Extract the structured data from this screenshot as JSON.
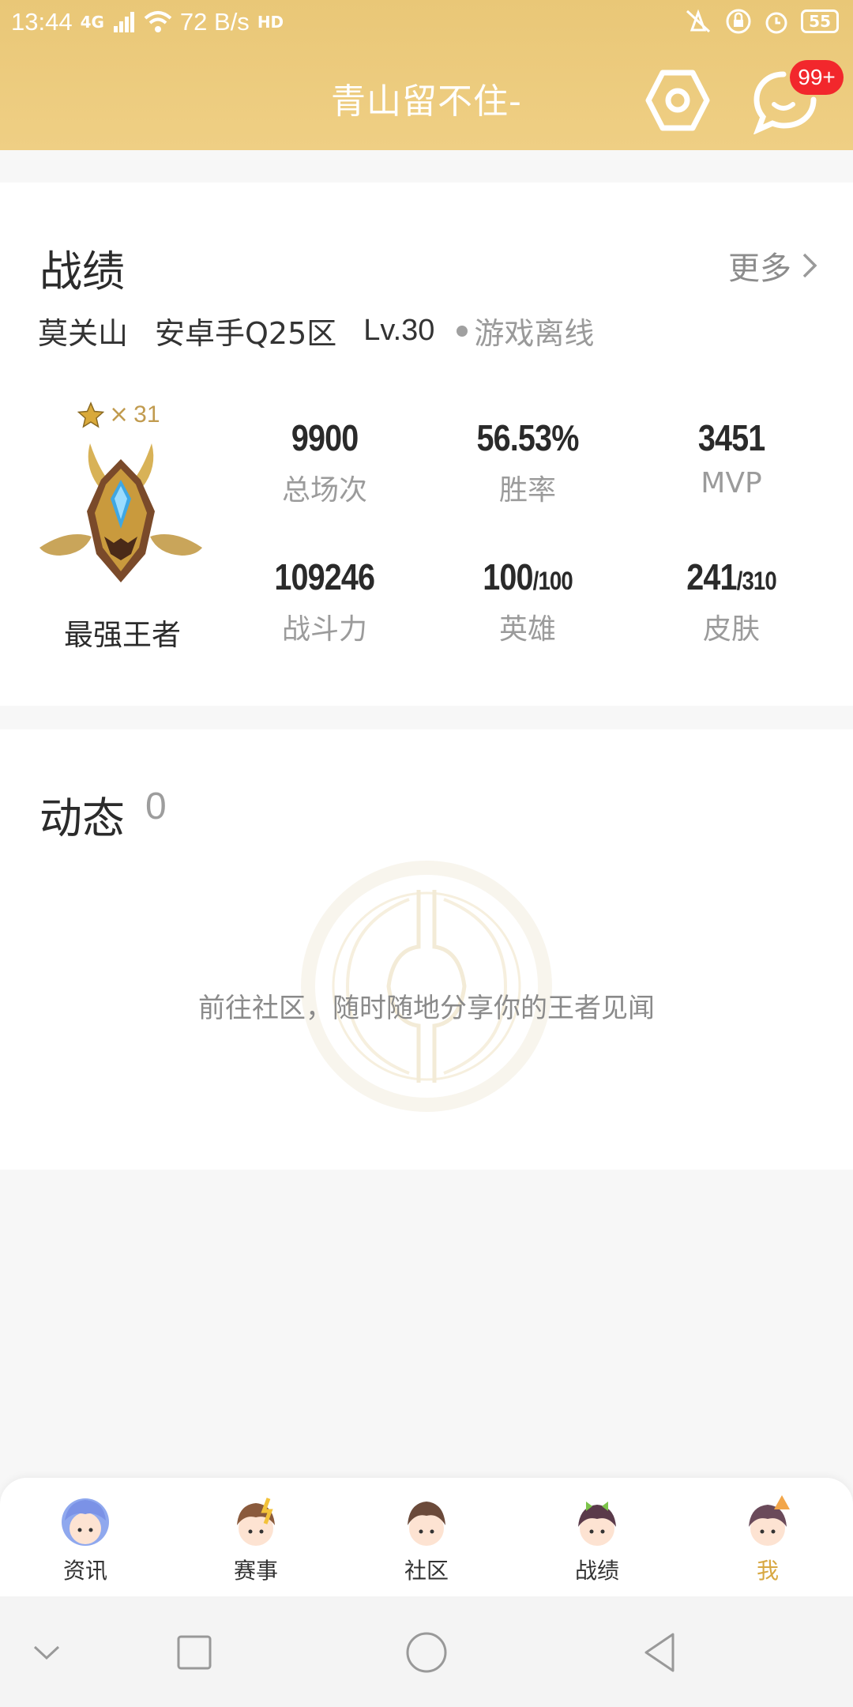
{
  "status_bar": {
    "time": "13:44",
    "network": "4G",
    "speed": "72 B/s",
    "hd": "HD",
    "battery": "55"
  },
  "header": {
    "title": "青山留不住-",
    "message_badge": "99+",
    "settings_icon": "hexagon-settings-icon",
    "message_icon": "chat-bubble-icon"
  },
  "record": {
    "title": "战绩",
    "more_label": "更多",
    "hero_name": "莫关山",
    "server": "安卓手Q25区",
    "level": "Lv.30",
    "status": "游戏离线",
    "rank": {
      "star_symbol": "×",
      "stars": "31",
      "name": "最强王者"
    },
    "stats": [
      {
        "value": "9900",
        "sub": "",
        "label": "总场次"
      },
      {
        "value": "56.53%",
        "sub": "",
        "label": "胜率"
      },
      {
        "value": "3451",
        "sub": "",
        "label": "MVP"
      },
      {
        "value": "109246",
        "sub": "",
        "label": "战斗力"
      },
      {
        "value": "100",
        "sub": "/100",
        "label": "英雄"
      },
      {
        "value": "241",
        "sub": "/310",
        "label": "皮肤"
      }
    ]
  },
  "feed": {
    "title": "动态",
    "count": "0",
    "empty_text": "前往社区，随时随地分享你的王者见闻"
  },
  "tabs": [
    {
      "label": "资讯",
      "active": false
    },
    {
      "label": "赛事",
      "active": false
    },
    {
      "label": "社区",
      "active": false
    },
    {
      "label": "战绩",
      "active": false
    },
    {
      "label": "我",
      "active": true
    }
  ],
  "colors": {
    "header": "#ecc97d",
    "accent": "#d8a842",
    "badge": "#f2272c"
  }
}
